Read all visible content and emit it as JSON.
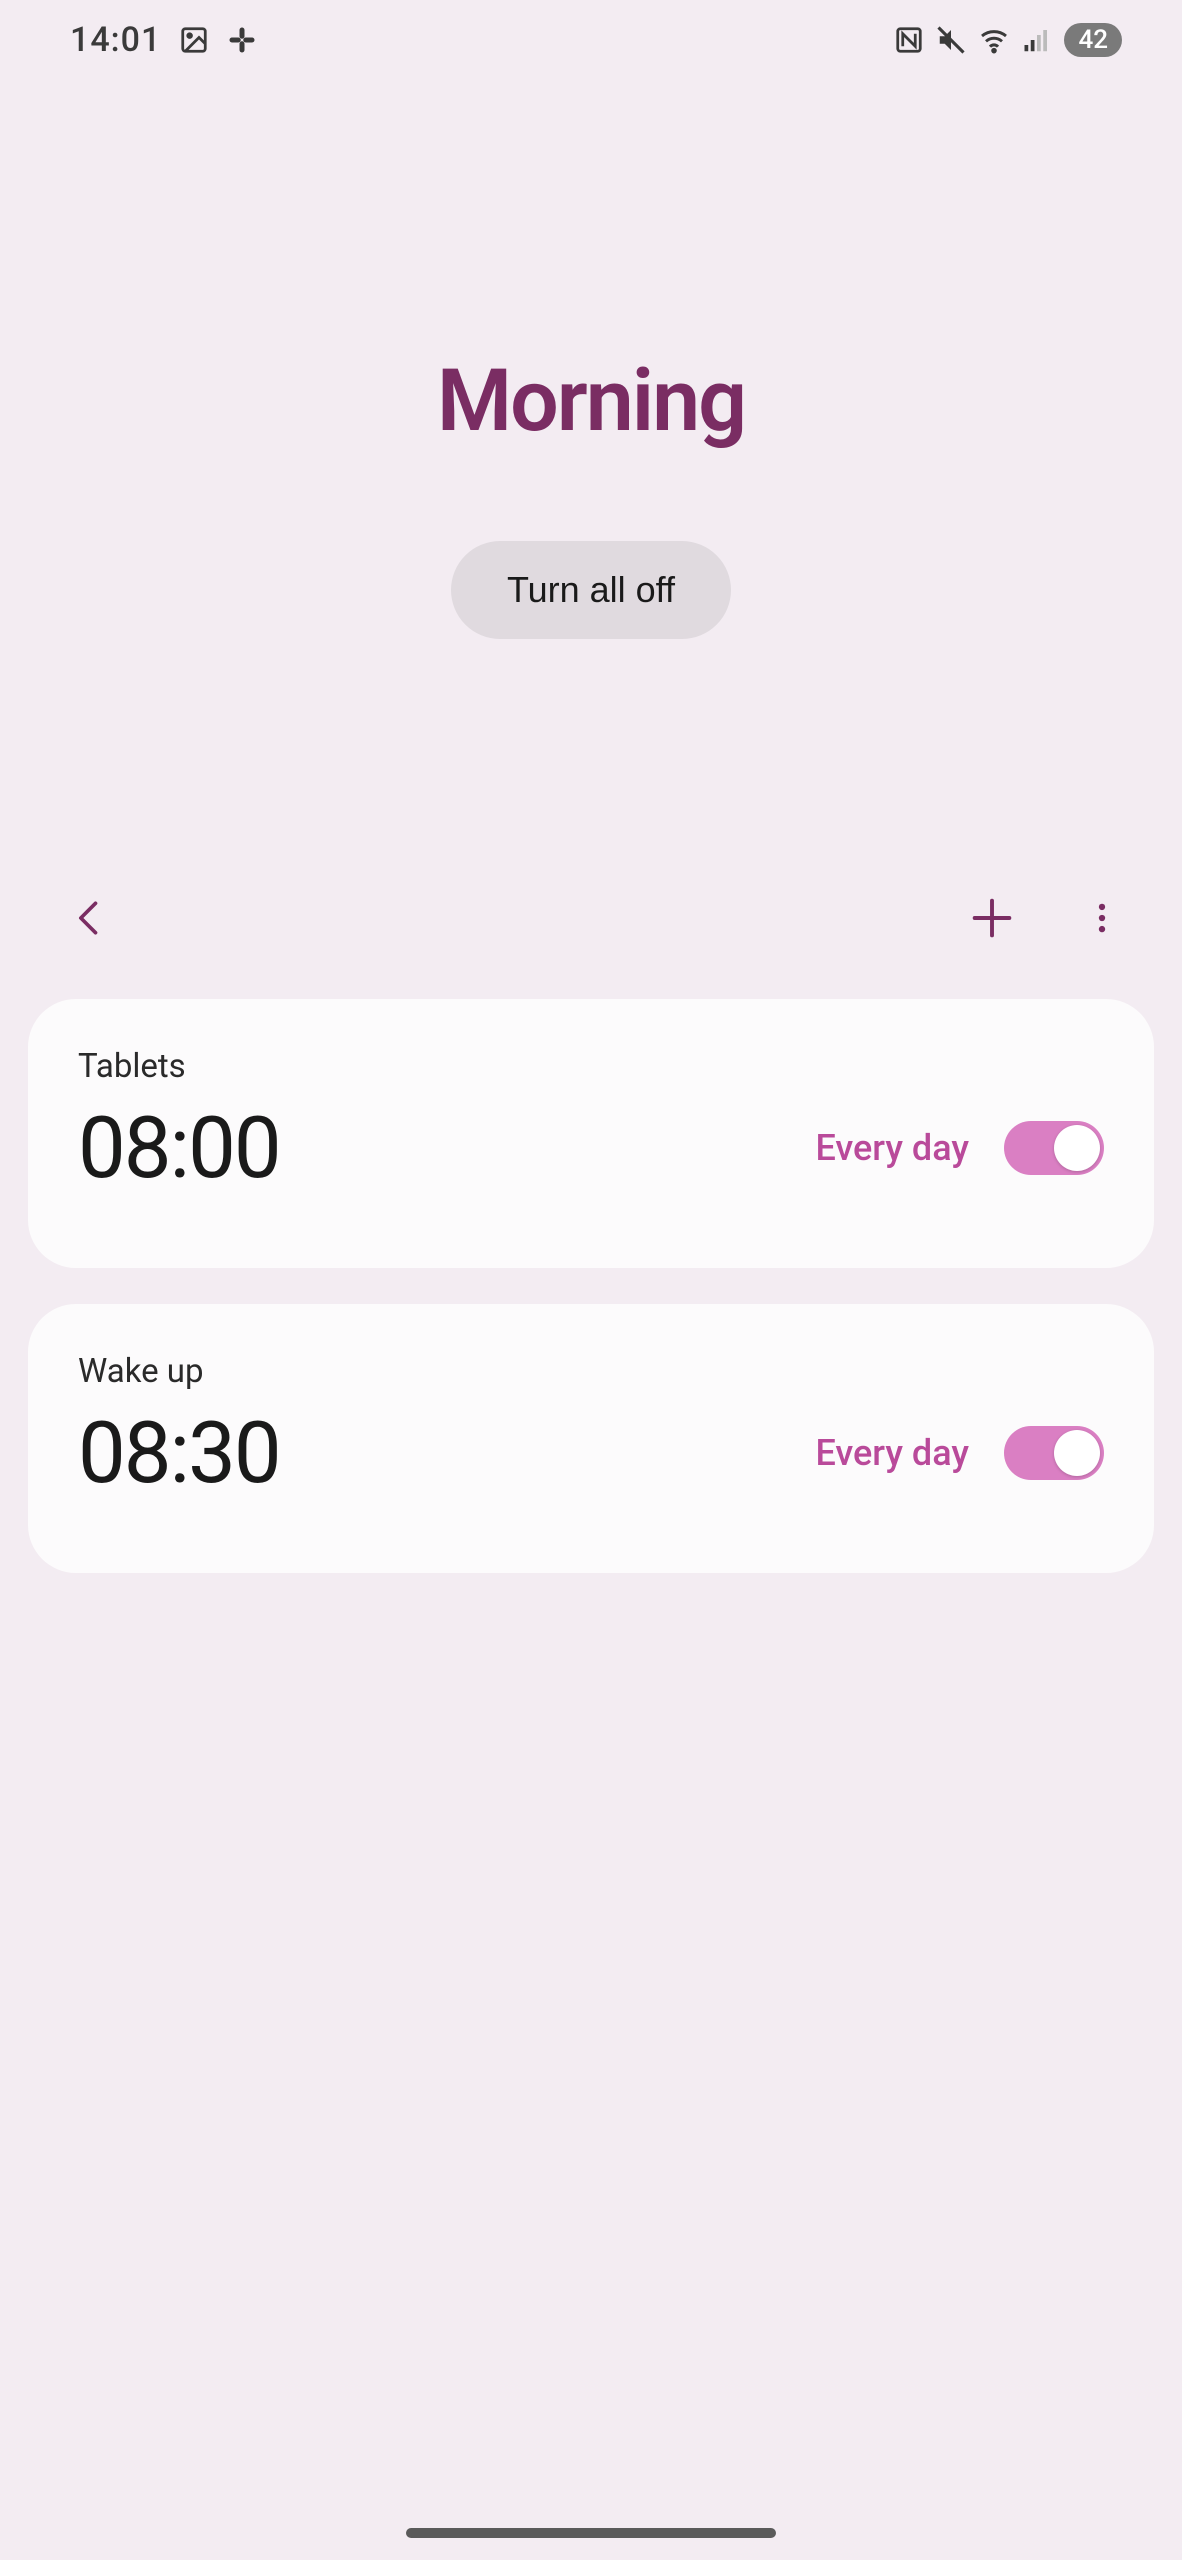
{
  "status": {
    "time": "14:01",
    "battery": "42"
  },
  "header": {
    "title": "Morning",
    "turn_all_label": "Turn all off"
  },
  "colors": {
    "accent": "#7a2d63",
    "toggle_on": "#da7fc3",
    "repeat_text": "#b94a9a"
  },
  "alarms": [
    {
      "label": "Tablets",
      "time": "08:00",
      "repeat": "Every day",
      "enabled": true
    },
    {
      "label": "Wake up",
      "time": "08:30",
      "repeat": "Every day",
      "enabled": true
    }
  ]
}
